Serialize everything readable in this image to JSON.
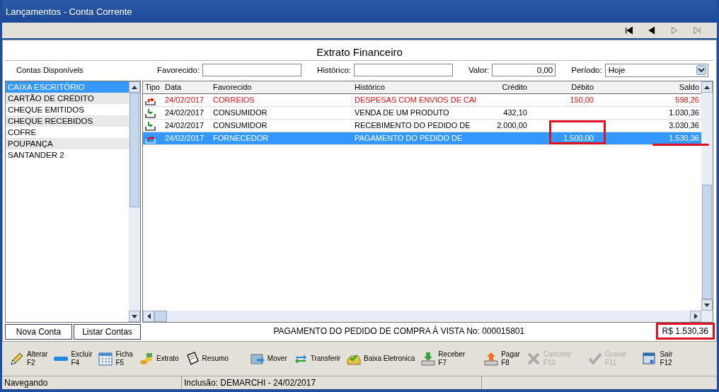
{
  "window": {
    "title": "Lançamentos - Conta Corrente"
  },
  "nav": [
    {
      "kind": "first",
      "disabled": false
    },
    {
      "kind": "prev",
      "disabled": false
    },
    {
      "kind": "next",
      "disabled": true
    },
    {
      "kind": "last",
      "disabled": true
    }
  ],
  "panel_title": "Extrato Financeiro",
  "accounts_label": "Contas Disponívels",
  "filters": [
    {
      "label": "Favorecido:"
    },
    {
      "label": "Histórico:"
    },
    {
      "label": "Valor:",
      "value": "0,00"
    }
  ],
  "period": {
    "label": "Período:",
    "value": "Hoje"
  },
  "accounts": [
    {
      "name": "CAIXA ESCRITÓRIO",
      "selected": true
    },
    {
      "name": "CARTÃO DE CRÉDITO",
      "selected": false
    },
    {
      "name": "CHEQUE EMITIDOS",
      "selected": false
    },
    {
      "name": "CHEQUE RECEBIDOS",
      "selected": false
    },
    {
      "name": "COFRE",
      "selected": false
    },
    {
      "name": "POUPANÇA",
      "selected": false
    },
    {
      "name": "SANTANDER 2",
      "selected": false
    }
  ],
  "table": {
    "columns": [
      "Tipo",
      "Data",
      "Favorecido",
      "Histórico",
      "Crédito",
      "Débito",
      "Saldo"
    ],
    "rows": [
      {
        "kind": "out",
        "alert": true,
        "selected": false,
        "data": "24/02/2017",
        "favorecido": "CORREIOS",
        "historico": "DESPESAS COM ENVIOS DE CAI",
        "credito": "",
        "debito": "150,00",
        "saldo": "598,26"
      },
      {
        "kind": "in",
        "alert": false,
        "selected": false,
        "data": "24/02/2017",
        "favorecido": "CONSUMIDOR",
        "historico": "VENDA DE UM PRODUTO",
        "credito": "432,10",
        "debito": "",
        "saldo": "1.030,36"
      },
      {
        "kind": "in",
        "alert": false,
        "selected": false,
        "data": "24/02/2017",
        "favorecido": "CONSUMIDOR",
        "historico": "RECEBIMENTO DO PEDIDO DE",
        "credito": "2.000,00",
        "debito": "",
        "saldo": "3.030,36"
      },
      {
        "kind": "out",
        "alert": false,
        "selected": true,
        "data": "24/02/2017",
        "favorecido": "FORNECEDOR",
        "historico": "PAGAMENTO DO PEDIDO DE",
        "credito": "",
        "debito": "1.500,00",
        "saldo": "1.530,36"
      }
    ]
  },
  "account_buttons": [
    "Nova Conta",
    "Listar Contas"
  ],
  "message": "PAGAMENTO DO PEDIDO DE COMPRA À VISTA No: 000015801",
  "total": "R$ 1.530,36",
  "toolbar": [
    {
      "label": "Alterar",
      "key": "F2",
      "disabled": false
    },
    {
      "label": "Excluir",
      "key": "F4",
      "disabled": false
    },
    {
      "label": "Ficha",
      "key": "F5",
      "disabled": false
    },
    {
      "label": "Extrato",
      "disabled": false
    },
    {
      "label": "Resumo",
      "disabled": false
    },
    {
      "label": "Mover",
      "disabled": false
    },
    {
      "label": "Transferir",
      "disabled": false
    },
    {
      "label": "Baixa Eletronica",
      "disabled": false
    },
    {
      "label": "Receber",
      "key": "F7",
      "disabled": false
    },
    {
      "label": "Pagar",
      "key": "F8",
      "disabled": false
    },
    {
      "label": "Cancelar",
      "key": "F10",
      "disabled": true
    },
    {
      "label": "Gravar",
      "key": "F11",
      "disabled": true
    },
    {
      "label": "Sair",
      "key": "F12",
      "disabled": false
    }
  ],
  "status_bar": [
    "Navegando",
    "Inclusão: DEMARCHI - 24/02/2017"
  ]
}
